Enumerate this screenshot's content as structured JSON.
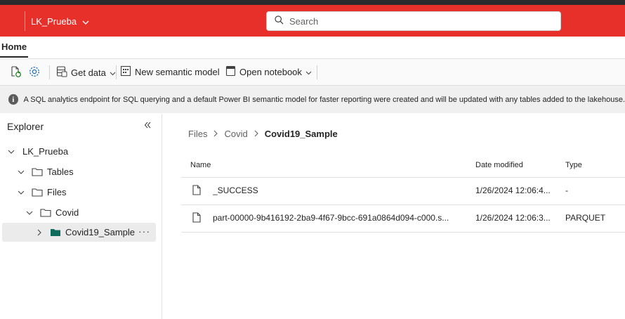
{
  "header": {
    "workspace_name": "LK_Prueba",
    "search_placeholder": "Search"
  },
  "tabs": [
    {
      "label": "Home",
      "active": true
    }
  ],
  "toolbar": {
    "get_data_label": "Get data",
    "new_semantic_model_label": "New semantic model",
    "open_notebook_label": "Open notebook"
  },
  "info_banner": {
    "icon": "info-icon",
    "text": "A SQL analytics endpoint for SQL querying and a default Power BI semantic model for faster reporting were created and will be updated with any tables added to the lakehouse."
  },
  "explorer": {
    "title": "Explorer",
    "tree": [
      {
        "label": "LK_Prueba",
        "expanded": true
      },
      {
        "label": "Tables",
        "expanded": false
      },
      {
        "label": "Files",
        "expanded": true
      },
      {
        "label": "Covid",
        "expanded": true
      },
      {
        "label": "Covid19_Sample",
        "expanded": false,
        "selected": true,
        "more": "···"
      }
    ]
  },
  "breadcrumb": [
    "Files",
    "Covid",
    "Covid19_Sample"
  ],
  "file_table": {
    "columns": [
      "Name",
      "Date modified",
      "Type"
    ],
    "rows": [
      {
        "name": "_SUCCESS",
        "date_modified": "1/26/2024 12:06:4...",
        "type": "-"
      },
      {
        "name": "part-00000-9b416192-2ba9-4f67-9bcc-691a0864d094-c000.s...",
        "date_modified": "1/26/2024 12:06:3...",
        "type": "PARQUET"
      }
    ]
  },
  "colors": {
    "brand_bar": "#e8302b",
    "selected_folder": "#0f6b5c"
  }
}
